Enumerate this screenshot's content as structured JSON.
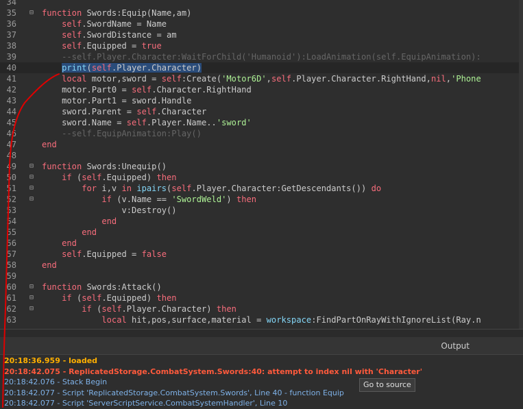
{
  "editor": {
    "lines": [
      {
        "num": "34",
        "fold": "",
        "html": ""
      },
      {
        "num": "35",
        "fold": "⊟",
        "html": "<span class=\"kw\">function</span> Swords:Equip(Name,am)"
      },
      {
        "num": "36",
        "fold": "",
        "html": "    <span class=\"self\">self</span>.SwordName = Name"
      },
      {
        "num": "37",
        "fold": "",
        "html": "    <span class=\"self\">self</span>.SwordDistance = am"
      },
      {
        "num": "38",
        "fold": "",
        "html": "    <span class=\"self\">self</span>.Equipped = <span class=\"kw\">true</span>"
      },
      {
        "num": "39",
        "fold": "",
        "html": "    <span class=\"cm\">--self.Player.Character:WaitForChild('Humanoid'):LoadAnimation(self.EquipAnimation):</span>"
      },
      {
        "num": "40",
        "fold": "",
        "html": "    <span class=\"sel\"><span class=\"bi\">print</span>(<span class=\"self\">self</span>.Player.Character)</span>"
      },
      {
        "num": "41",
        "fold": "",
        "html": "    <span class=\"kw\">local</span> motor,sword = <span class=\"self\">self</span>:Create(<span class=\"str\">'Motor6D'</span>,<span class=\"self\">self</span>.Player.Character.RightHand,<span class=\"kw\">nil</span>,<span class=\"str\">'Phone</span>"
      },
      {
        "num": "42",
        "fold": "",
        "html": "    motor.Part0 = <span class=\"self\">self</span>.Character.RightHand"
      },
      {
        "num": "43",
        "fold": "",
        "html": "    motor.Part1 = sword.Handle"
      },
      {
        "num": "44",
        "fold": "",
        "html": "    sword.Parent = <span class=\"self\">self</span>.Character"
      },
      {
        "num": "45",
        "fold": "",
        "html": "    sword.Name = <span class=\"self\">self</span>.Player.Name..<span class=\"str\">'sword'</span>"
      },
      {
        "num": "46",
        "fold": "",
        "html": "    <span class=\"cm\">--self.EquipAnimation:Play()</span>"
      },
      {
        "num": "47",
        "fold": "",
        "html": "<span class=\"kw\">end</span>"
      },
      {
        "num": "48",
        "fold": "",
        "html": ""
      },
      {
        "num": "49",
        "fold": "⊟",
        "html": "<span class=\"kw\">function</span> Swords:Unequip()"
      },
      {
        "num": "50",
        "fold": "⊟",
        "html": "    <span class=\"kw\">if</span> (<span class=\"self\">self</span>.Equipped) <span class=\"kw\">then</span>"
      },
      {
        "num": "51",
        "fold": "⊟",
        "html": "        <span class=\"kw\">for</span> i,v <span class=\"kw\">in</span> <span class=\"bi\">ipairs</span>(<span class=\"self\">self</span>.Player.Character:GetDescendants()) <span class=\"kw\">do</span>"
      },
      {
        "num": "52",
        "fold": "⊟",
        "html": "            <span class=\"kw\">if</span> (v.Name == <span class=\"str\">'SwordWeld'</span>) <span class=\"kw\">then</span>"
      },
      {
        "num": "53",
        "fold": "",
        "html": "                v:Destroy()"
      },
      {
        "num": "54",
        "fold": "",
        "html": "            <span class=\"kw\">end</span>"
      },
      {
        "num": "55",
        "fold": "",
        "html": "        <span class=\"kw\">end</span>"
      },
      {
        "num": "56",
        "fold": "",
        "html": "    <span class=\"kw\">end</span>"
      },
      {
        "num": "57",
        "fold": "",
        "html": "    <span class=\"self\">self</span>.Equipped = <span class=\"kw\">false</span>"
      },
      {
        "num": "58",
        "fold": "",
        "html": "<span class=\"kw\">end</span>"
      },
      {
        "num": "59",
        "fold": "",
        "html": ""
      },
      {
        "num": "60",
        "fold": "⊟",
        "html": "<span class=\"kw\">function</span> Swords:Attack()"
      },
      {
        "num": "61",
        "fold": "⊟",
        "html": "    <span class=\"kw\">if</span> (<span class=\"self\">self</span>.Equipped) <span class=\"kw\">then</span>"
      },
      {
        "num": "62",
        "fold": "⊟",
        "html": "        <span class=\"kw\">if</span> (<span class=\"self\">self</span>.Player.Character) <span class=\"kw\">then</span>"
      },
      {
        "num": "63",
        "fold": "",
        "html": "            <span class=\"kw\">local</span> hit,pos,surface,material = <span class=\"bi\">workspace</span>:FindPartOnRayWithIgnoreList(Ray.n"
      }
    ]
  },
  "output": {
    "title": "Output",
    "lines": [
      {
        "text": "20:18:36.959 - loaded",
        "kind": "warn"
      },
      {
        "text": "20:18:42.075 - ReplicatedStorage.CombatSystem.Swords:40: attempt to index nil with 'Character'",
        "kind": "err"
      },
      {
        "text": "20:18:42.076 - Stack Begin",
        "kind": "info"
      },
      {
        "text": "20:18:42.077 - Script 'ReplicatedStorage.CombatSystem.Swords', Line 40 - function Equip",
        "kind": "info"
      },
      {
        "text": "20:18:42.077 - Script 'ServerScriptService.CombatSystemHandler', Line 10",
        "kind": "info"
      }
    ],
    "tooltip": "Go to source"
  },
  "colors": {
    "background": "#2e2e2e",
    "keyword": "#f86d7c",
    "string": "#adf195",
    "comment": "#666666",
    "builtin": "#84d6f7",
    "error": "#ff5a3c",
    "warning": "#ffb000",
    "info": "#7fb2e8",
    "annotation": "#e00000"
  }
}
